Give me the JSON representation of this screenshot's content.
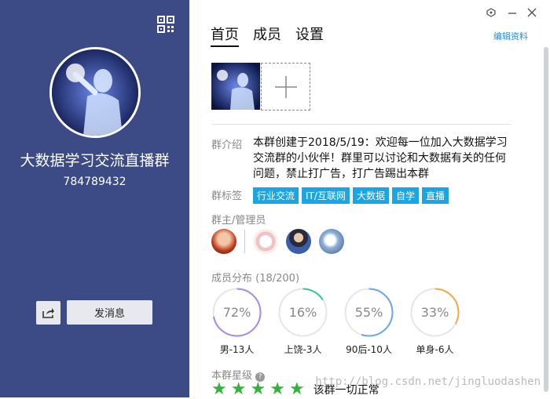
{
  "left": {
    "group_name": "大数据学习交流直播群",
    "group_id": "784789432",
    "send_message_label": "发消息"
  },
  "tabs": [
    {
      "label": "首页"
    },
    {
      "label": "成员"
    },
    {
      "label": "设置"
    }
  ],
  "edit_link": "编辑资料",
  "intro": {
    "label": "群介绍",
    "text": "本群创建于2018/5/19：欢迎每一位加入大数据学习交流群的小伙伴！群里可以讨论和大数据有关的任何问题，禁止打广告，打广告踢出本群"
  },
  "tags": {
    "label": "群标签",
    "items": [
      "行业交流",
      "IT/互联网",
      "大数据",
      "自学",
      "直播"
    ]
  },
  "admins": {
    "label": "群主/管理员"
  },
  "distribution": {
    "label": "成员分布 (18/200)",
    "rings": [
      {
        "percent": 72,
        "display": "72%",
        "caption": "男-13人",
        "color": "#a88ae0"
      },
      {
        "percent": 16,
        "display": "16%",
        "caption": "上饶-3人",
        "color": "#39c48f"
      },
      {
        "percent": 55,
        "display": "55%",
        "caption": "90后-10人",
        "color": "#6aa6ee"
      },
      {
        "percent": 33,
        "display": "33%",
        "caption": "单身-6人",
        "color": "#f2a94a"
      }
    ]
  },
  "rating": {
    "label": "本群星级",
    "stars": 5,
    "text": "该群一切正常"
  },
  "watermark": "http://blog.csdn.net/jingluodashen",
  "colors": {
    "sidebar": "#3c4b85",
    "tag": "#19a6e5",
    "star": "#34b33b",
    "link": "#2a8bd8"
  }
}
